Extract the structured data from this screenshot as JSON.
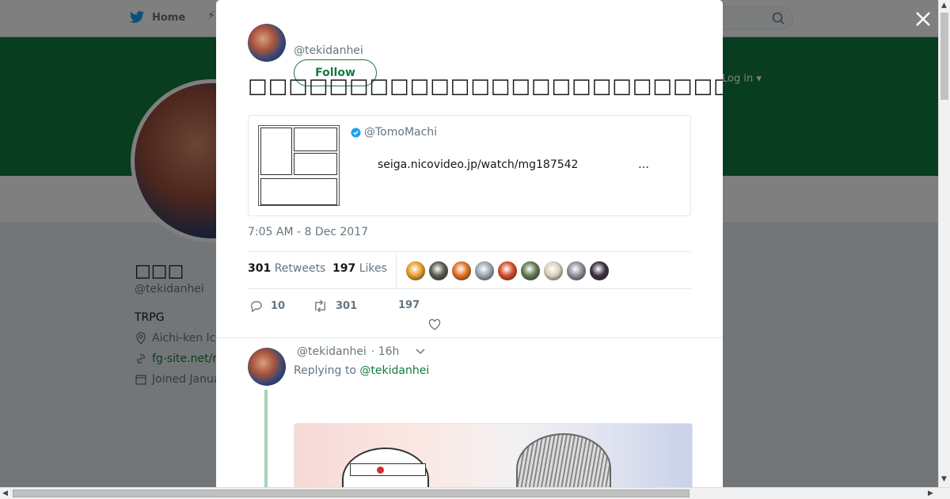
{
  "topbar": {
    "home_label": "Home",
    "login_label": "Log in ▾"
  },
  "profile": {
    "name": "□□□",
    "handle": "@tekidanhei",
    "bio": "TRPG",
    "location": "Aichi-ken Ic",
    "website": "fg-site.net/r",
    "joined": "Joined Janua"
  },
  "tweet": {
    "handle": "@tekidanhei",
    "follow_label": "Follow",
    "text": "□□□□□□□□□□□□□□□□□□□□□□□□□□□□□□□□□□□□□□□□□□□□□□□□□□",
    "quote": {
      "handle": "@TomoMachi",
      "link": "seiga.nicovideo.jp/watch/mg187542",
      "ellipsis": "…"
    },
    "timestamp": "7:05 AM - 8 Dec 2017",
    "retweets_count": "301",
    "retweets_label": "Retweets",
    "likes_count": "197",
    "likes_label": "Likes",
    "likers": [
      "#e89c2a",
      "#555b4a",
      "#e0701e",
      "#9aa5b1",
      "#d44c2a",
      "#5f7a4e",
      "#d8cfb8",
      "#8a8f96",
      "#3a3040"
    ],
    "actions": {
      "reply_count": "10",
      "retweet_count": "301",
      "like_count": "197"
    }
  },
  "reply": {
    "handle": "@tekidanhei",
    "time": "· 16h",
    "replying_prefix": "Replying to ",
    "replying_to": "@tekidanhei"
  },
  "colors": {
    "accent": "#117a3f",
    "thread_line": "#a3d4b6"
  }
}
